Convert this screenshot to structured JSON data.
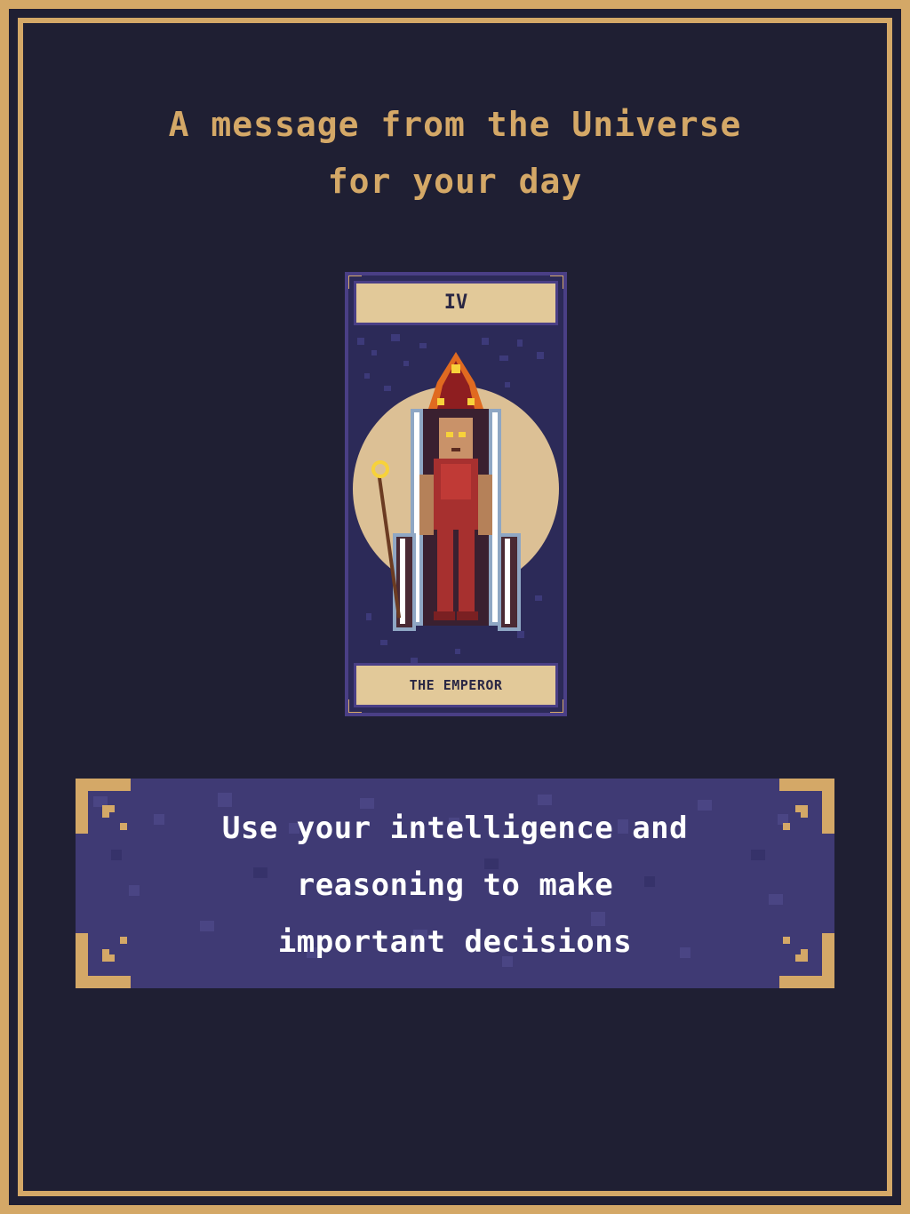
{
  "header": {
    "line1": "A message from the Universe",
    "line2": "for your day"
  },
  "card": {
    "numeral": "IV",
    "name": "THE EMPEROR"
  },
  "message": {
    "line1": "Use your intelligence and",
    "line2": "reasoning to make",
    "line3": "important decisions"
  },
  "colors": {
    "frame_gold": "#d4a867",
    "background": "#1f1f33",
    "banner_purple": "#3f3a74",
    "card_label_bg": "#e2c999"
  }
}
